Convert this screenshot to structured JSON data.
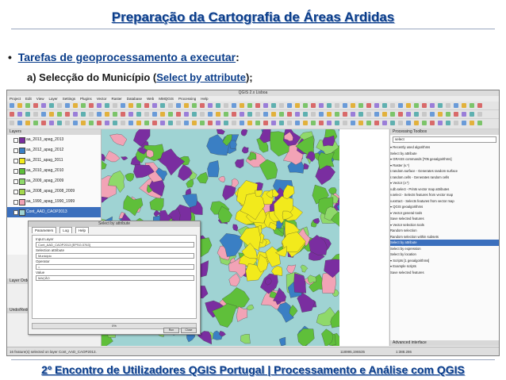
{
  "slide": {
    "title": "Preparação da Cartografia de Áreas Ardidas",
    "bullet_link": "Tarefas de geoprocessamento a executar",
    "bullet_suffix": ":",
    "sub_prefix": "a) Selecção do Município (",
    "sub_link": "Select by attribute",
    "sub_suffix": ");",
    "footer": "2º Encontro de Utilizadores QGIS Portugal   |   Processamento e Análise com QGIS"
  },
  "qgis": {
    "window_title": "QGIS 2.x Lisboa",
    "menu": [
      "Project",
      "Edit",
      "View",
      "Layer",
      "Settings",
      "Plugins",
      "Vector",
      "Raster",
      "Database",
      "Web",
      "MMQGIS",
      "Processing",
      "Help"
    ],
    "layers_title": "Layers",
    "layers": [
      {
        "name": "aa_2013_apag_2013",
        "color": "#7a2ea0"
      },
      {
        "name": "aa_2012_apag_2012",
        "color": "#3a7fc4"
      },
      {
        "name": "aa_2011_apag_2011",
        "color": "#f2ea1c"
      },
      {
        "name": "aa_2010_apag_2010",
        "color": "#5fbf3a"
      },
      {
        "name": "aa_2009_apag_2009",
        "color": "#8fd96a"
      },
      {
        "name": "aa_2008_apag_2008_2009",
        "color": "#a4d84e"
      },
      {
        "name": "aa_1990_apag_1990_1999",
        "color": "#f2a3b6"
      },
      {
        "name": "Cont_AAD_CAOP2013",
        "color": "#9fd3d3"
      }
    ],
    "left_lower": [
      "Layer Order",
      "Undo/Redo"
    ],
    "dialog": {
      "title": "Select by attribute",
      "tabs": [
        "Parameters",
        "Log",
        "Help"
      ],
      "fields": [
        {
          "label": "Input Layer",
          "value": "Cont_AAD_CAOP2013 [EPSG:3763]"
        },
        {
          "label": "Selection attribute",
          "value": "Municipio"
        },
        {
          "label": "Operator",
          "value": "="
        },
        {
          "label": "Value",
          "value": "MAÇÃO"
        }
      ],
      "progress": "0%",
      "run_button": "Run",
      "close_button": "Close"
    },
    "toolbox": {
      "title": "Processing Toolbox",
      "search_value": "select",
      "rows": [
        {
          "text": "▾ Recently used algorithms",
          "hl": false
        },
        {
          "text": "    Select by attribute",
          "hl": false
        },
        {
          "text": "▾ GRASS commands [705 geoalgorithms]",
          "hl": false
        },
        {
          "text": "  ▾ Raster (v.*)",
          "hl": false
        },
        {
          "text": "      r.random.surface - Generates random surface",
          "hl": false
        },
        {
          "text": "      r.random.cells - Generates random cells",
          "hl": false
        },
        {
          "text": "  ▾ Vector (v.*)",
          "hl": false
        },
        {
          "text": "      v.db.select - Prints vector map attributes",
          "hl": false
        },
        {
          "text": "      v.select - Selects features from vector map",
          "hl": false
        },
        {
          "text": "      v.extract - Selects features from vector map",
          "hl": false
        },
        {
          "text": "▾ QGIS geoalgorithms",
          "hl": false
        },
        {
          "text": "  ▾ Vector general tools",
          "hl": false
        },
        {
          "text": "      Save selected features",
          "hl": false
        },
        {
          "text": "  ▾ Vector selection tools",
          "hl": false
        },
        {
          "text": "      Random selection",
          "hl": false
        },
        {
          "text": "      Random selection within subsets",
          "hl": false
        },
        {
          "text": "      Select by attribute",
          "hl": true
        },
        {
          "text": "      Select by expression",
          "hl": false
        },
        {
          "text": "      Select by location",
          "hl": false
        },
        {
          "text": "▾ Scripts [1 geoalgorithms]",
          "hl": false
        },
        {
          "text": "  ▾ Example scripts",
          "hl": false
        },
        {
          "text": "      Save selected features",
          "hl": false
        }
      ],
      "footer": "Advanced interface"
    },
    "status": {
      "left": "16 feature(s) selected on layer Cont_AAD_CAOP2013.",
      "coordinate": "118995,196535",
      "scale": "1:388.286"
    },
    "colors": {
      "map_bg": "#9fd3d3",
      "purple": "#7a2ea0",
      "yellow": "#f2ea1c",
      "green": "#5fbf3a",
      "light_green": "#8fd96a",
      "pink": "#f2a3b6",
      "blue": "#3a7fc4",
      "selection_blue": "#3b6fbd"
    }
  }
}
